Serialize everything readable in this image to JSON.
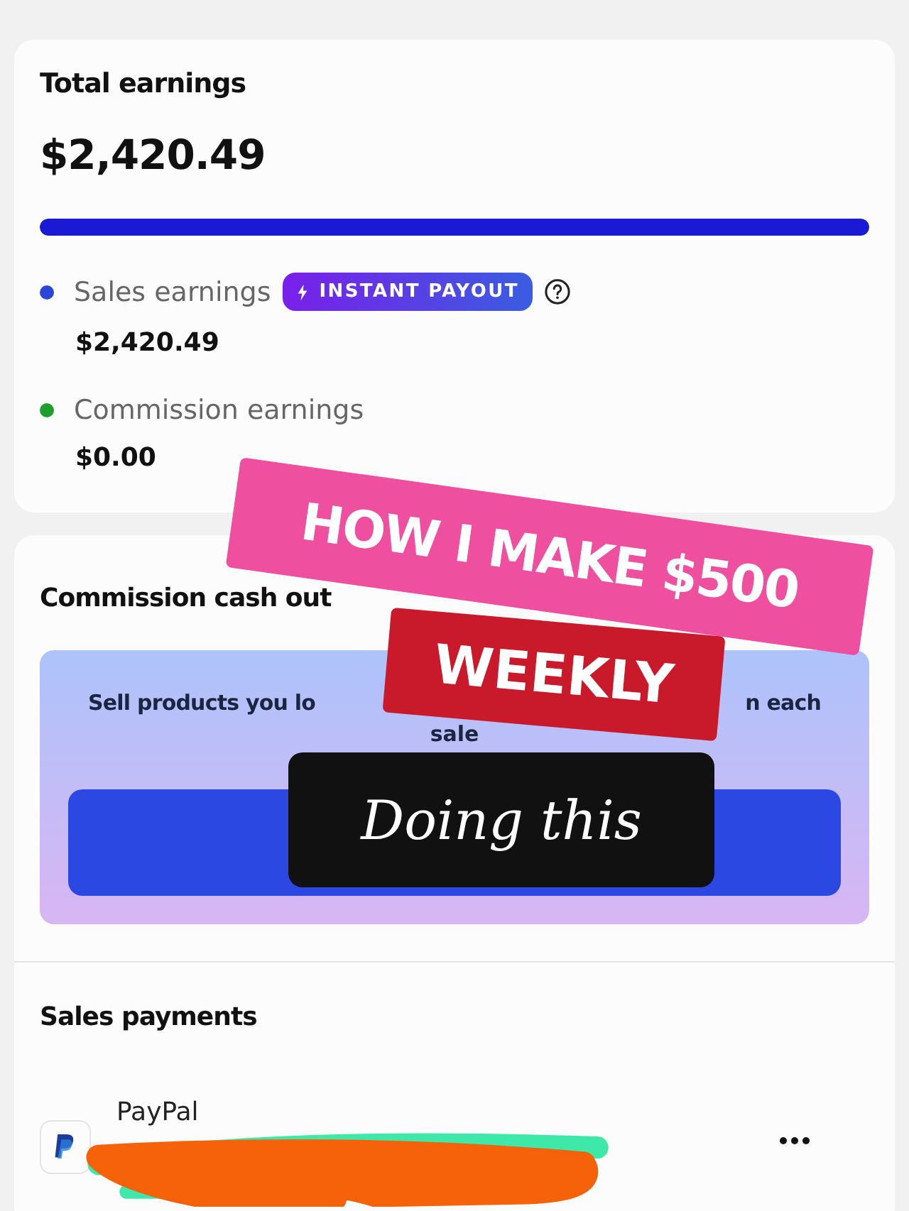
{
  "earnings": {
    "title": "Total earnings",
    "total": "$2,420.49",
    "bar": {
      "level": 1
    },
    "items": [
      {
        "label": "Sales earnings",
        "color": "#2b45d6",
        "badge": "INSTANT PAYOUT",
        "help": true,
        "amount": "$2,420.49"
      },
      {
        "label": "Commission earnings",
        "color": "#1f9e2e",
        "help": false,
        "amount": "$0.00"
      }
    ]
  },
  "cashout": {
    "title": "Commission cash out",
    "text_parts": [
      "Sell products you lo",
      "n each"
    ],
    "text_tail": "sale"
  },
  "sales_payments": {
    "title": "Sales payments",
    "methods": [
      {
        "name": "PayPal"
      }
    ]
  },
  "stickers": [
    {
      "kind": "pink",
      "text": "HOW I MAKE $500"
    },
    {
      "kind": "red",
      "text": "WEEKLY"
    },
    {
      "kind": "black",
      "text": "Doing this"
    }
  ]
}
